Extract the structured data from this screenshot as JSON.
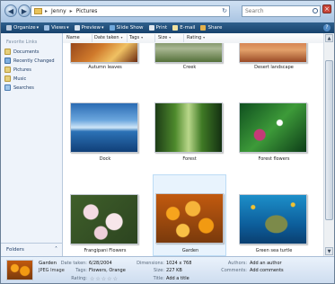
{
  "address": {
    "crumbs": [
      "Jenny",
      "Pictures"
    ]
  },
  "search": {
    "placeholder": "Search"
  },
  "toolbar": {
    "organize": "Organize",
    "views": "Views",
    "preview": "Preview",
    "slideshow": "Slide Show",
    "print": "Print",
    "email": "E-mail",
    "share": "Share"
  },
  "nav": {
    "title": "Favorite Links",
    "items": [
      "Documents",
      "Recently Changed",
      "Pictures",
      "Music",
      "Searches"
    ],
    "folders": "Folders"
  },
  "columns": [
    "Name",
    "Date taken",
    "Tags",
    "Size",
    "Rating"
  ],
  "items": [
    {
      "caption": "Autumn leaves"
    },
    {
      "caption": "Creek"
    },
    {
      "caption": "Desert landscape"
    },
    {
      "caption": "Dock"
    },
    {
      "caption": "Forest"
    },
    {
      "caption": "Forest flowers"
    },
    {
      "caption": "Frangipani Flowers"
    },
    {
      "caption": "Garden"
    },
    {
      "caption": "Green sea turtle"
    }
  ],
  "details": {
    "name": "Garden",
    "type": "JPEG Image",
    "date_label": "Date taken:",
    "date": "6/28/2004",
    "tags_label": "Tags:",
    "tags": "Flowers, Orange",
    "rating_label": "Rating:",
    "rating": 0,
    "dimensions_label": "Dimensions:",
    "dimensions": "1024 x 768",
    "size_label": "Size:",
    "size": "227 KB",
    "title_label": "Title:",
    "title": "Add a title",
    "authors_label": "Authors:",
    "authors": "Add an author",
    "comments_label": "Comments:",
    "comments": "Add comments"
  },
  "colors": {
    "toolbar": "#1f4b77",
    "selection": "#e8f3fd",
    "link": "#1e3c66"
  }
}
